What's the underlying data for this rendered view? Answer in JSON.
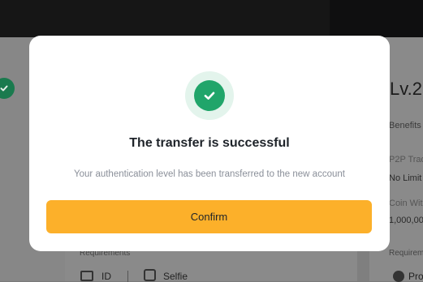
{
  "background": {
    "level_title": "Lv.2",
    "benefits_label": "Benefits",
    "p2p_label": "P2P Trad",
    "p2p_value": "No Limit",
    "coin_withdrawal_label": "Coin Wit",
    "coin_withdrawal_value": "1,000,00",
    "requirements_label_mid": "Requirements",
    "requirements_label_right": "Requirem",
    "requirement_id": "ID",
    "requirement_selfie": "Selfie",
    "requirement_pro": "Pro"
  },
  "modal": {
    "icon": "check-circle-icon",
    "title": "The transfer is successful",
    "message": "Your authentication level has been transferred to the new account",
    "confirm_label": "Confirm",
    "accent_color": "#fcb02a",
    "success_color": "#20a56a"
  }
}
